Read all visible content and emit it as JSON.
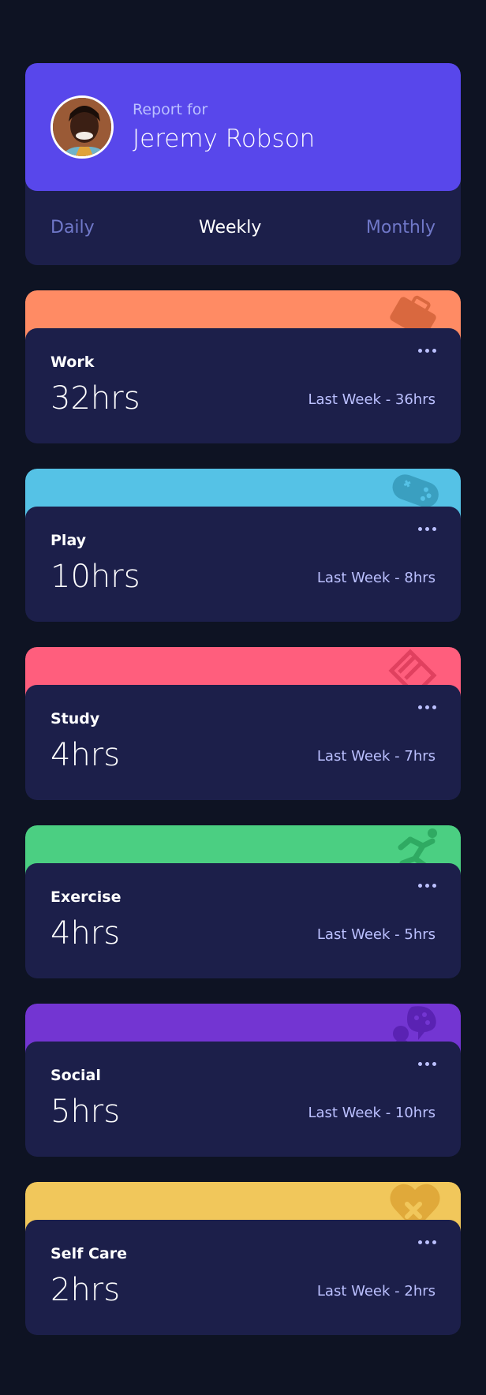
{
  "profile": {
    "report_for": "Report for",
    "name": "Jeremy Robson"
  },
  "tabs": [
    {
      "label": "Daily",
      "active": false
    },
    {
      "label": "Weekly",
      "active": true
    },
    {
      "label": "Monthly",
      "active": false
    }
  ],
  "cards": [
    {
      "title": "Work",
      "hours": "32hrs",
      "last": "Last Week - 36hrs",
      "color": "#ff8b64",
      "icon": "work-briefcase-icon"
    },
    {
      "title": "Play",
      "hours": "10hrs",
      "last": "Last Week - 8hrs",
      "color": "#55c2e6",
      "icon": "play-gamepad-icon"
    },
    {
      "title": "Study",
      "hours": "4hrs",
      "last": "Last Week - 7hrs",
      "color": "#ff5e7d",
      "icon": "study-book-icon"
    },
    {
      "title": "Exercise",
      "hours": "4hrs",
      "last": "Last Week - 5hrs",
      "color": "#4bcf82",
      "icon": "exercise-runner-icon"
    },
    {
      "title": "Social",
      "hours": "5hrs",
      "last": "Last Week - 10hrs",
      "color": "#7335d2",
      "icon": "social-chat-icon"
    },
    {
      "title": "Self Care",
      "hours": "2hrs",
      "last": "Last Week - 2hrs",
      "color": "#f1c75b",
      "icon": "self-care-heart-icon"
    }
  ]
}
